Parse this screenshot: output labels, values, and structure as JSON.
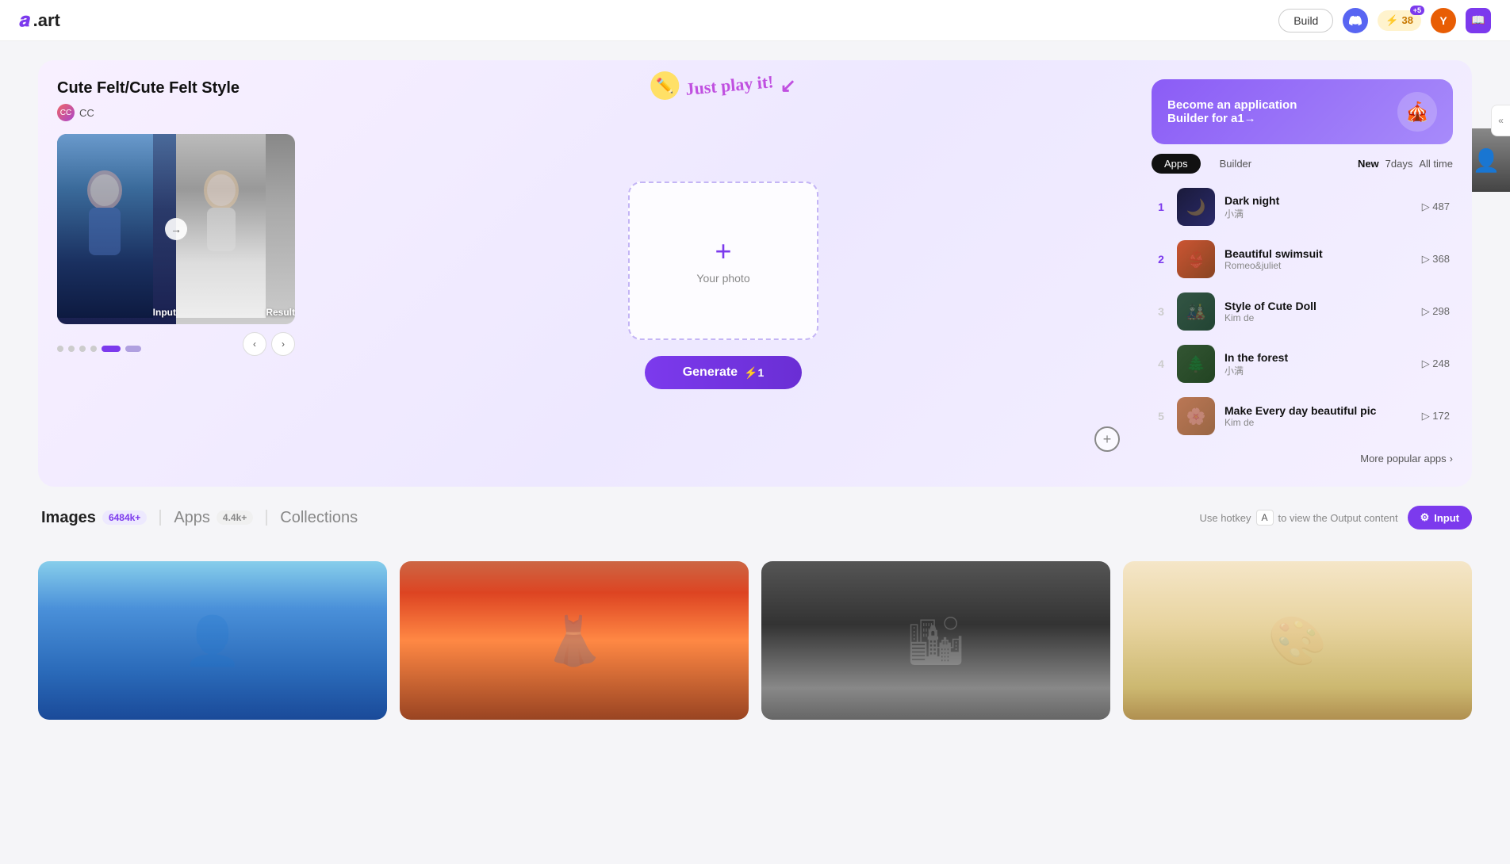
{
  "header": {
    "logo_text": ".art",
    "build_label": "Build",
    "lightning_count": "38",
    "lightning_plus": "+5",
    "avatar_letter": "Y"
  },
  "hero": {
    "title": "Cute Felt/Cute Felt Style",
    "author": "CC",
    "input_label": "Input",
    "result_label": "Result",
    "play_hint": "Just play it!",
    "upload_label": "Your photo",
    "generate_label": "Generate",
    "generate_cost": "⚡1",
    "become_builder_line1": "Become an application",
    "become_builder_line2": "Builder for a1→"
  },
  "apps_tabs": {
    "tab_apps": "Apps",
    "tab_builder": "Builder",
    "filter_new": "New",
    "filter_7days": "7days",
    "filter_alltime": "All time"
  },
  "apps_list": [
    {
      "rank": "1",
      "name": "Dark night",
      "author": "小满",
      "count": "487",
      "thumb_class": "thumb-dark"
    },
    {
      "rank": "2",
      "name": "Beautiful swimsuit",
      "author": "Romeo&juliet",
      "count": "368",
      "thumb_class": "thumb-beach"
    },
    {
      "rank": "3",
      "name": "Style of Cute Doll",
      "author": "Kim de",
      "count": "298",
      "thumb_class": "thumb-doll"
    },
    {
      "rank": "4",
      "name": "In the forest",
      "author": "小满",
      "count": "248",
      "thumb_class": "thumb-forest"
    },
    {
      "rank": "5",
      "name": "Make Every day beautiful pic",
      "author": "Kim de",
      "count": "172",
      "thumb_class": "thumb-beauty"
    }
  ],
  "more_apps": "More popular apps",
  "content_tabs": {
    "images_label": "Images",
    "images_count": "6484k+",
    "apps_label": "Apps",
    "apps_count": "4.4k+",
    "collections_label": "Collections"
  },
  "toolbar": {
    "hotkey_label": "Use hotkey",
    "hotkey_key": "A",
    "hotkey_suffix": "to view the Output content",
    "input_btn": "Input"
  },
  "sidebar_collapse": "«"
}
